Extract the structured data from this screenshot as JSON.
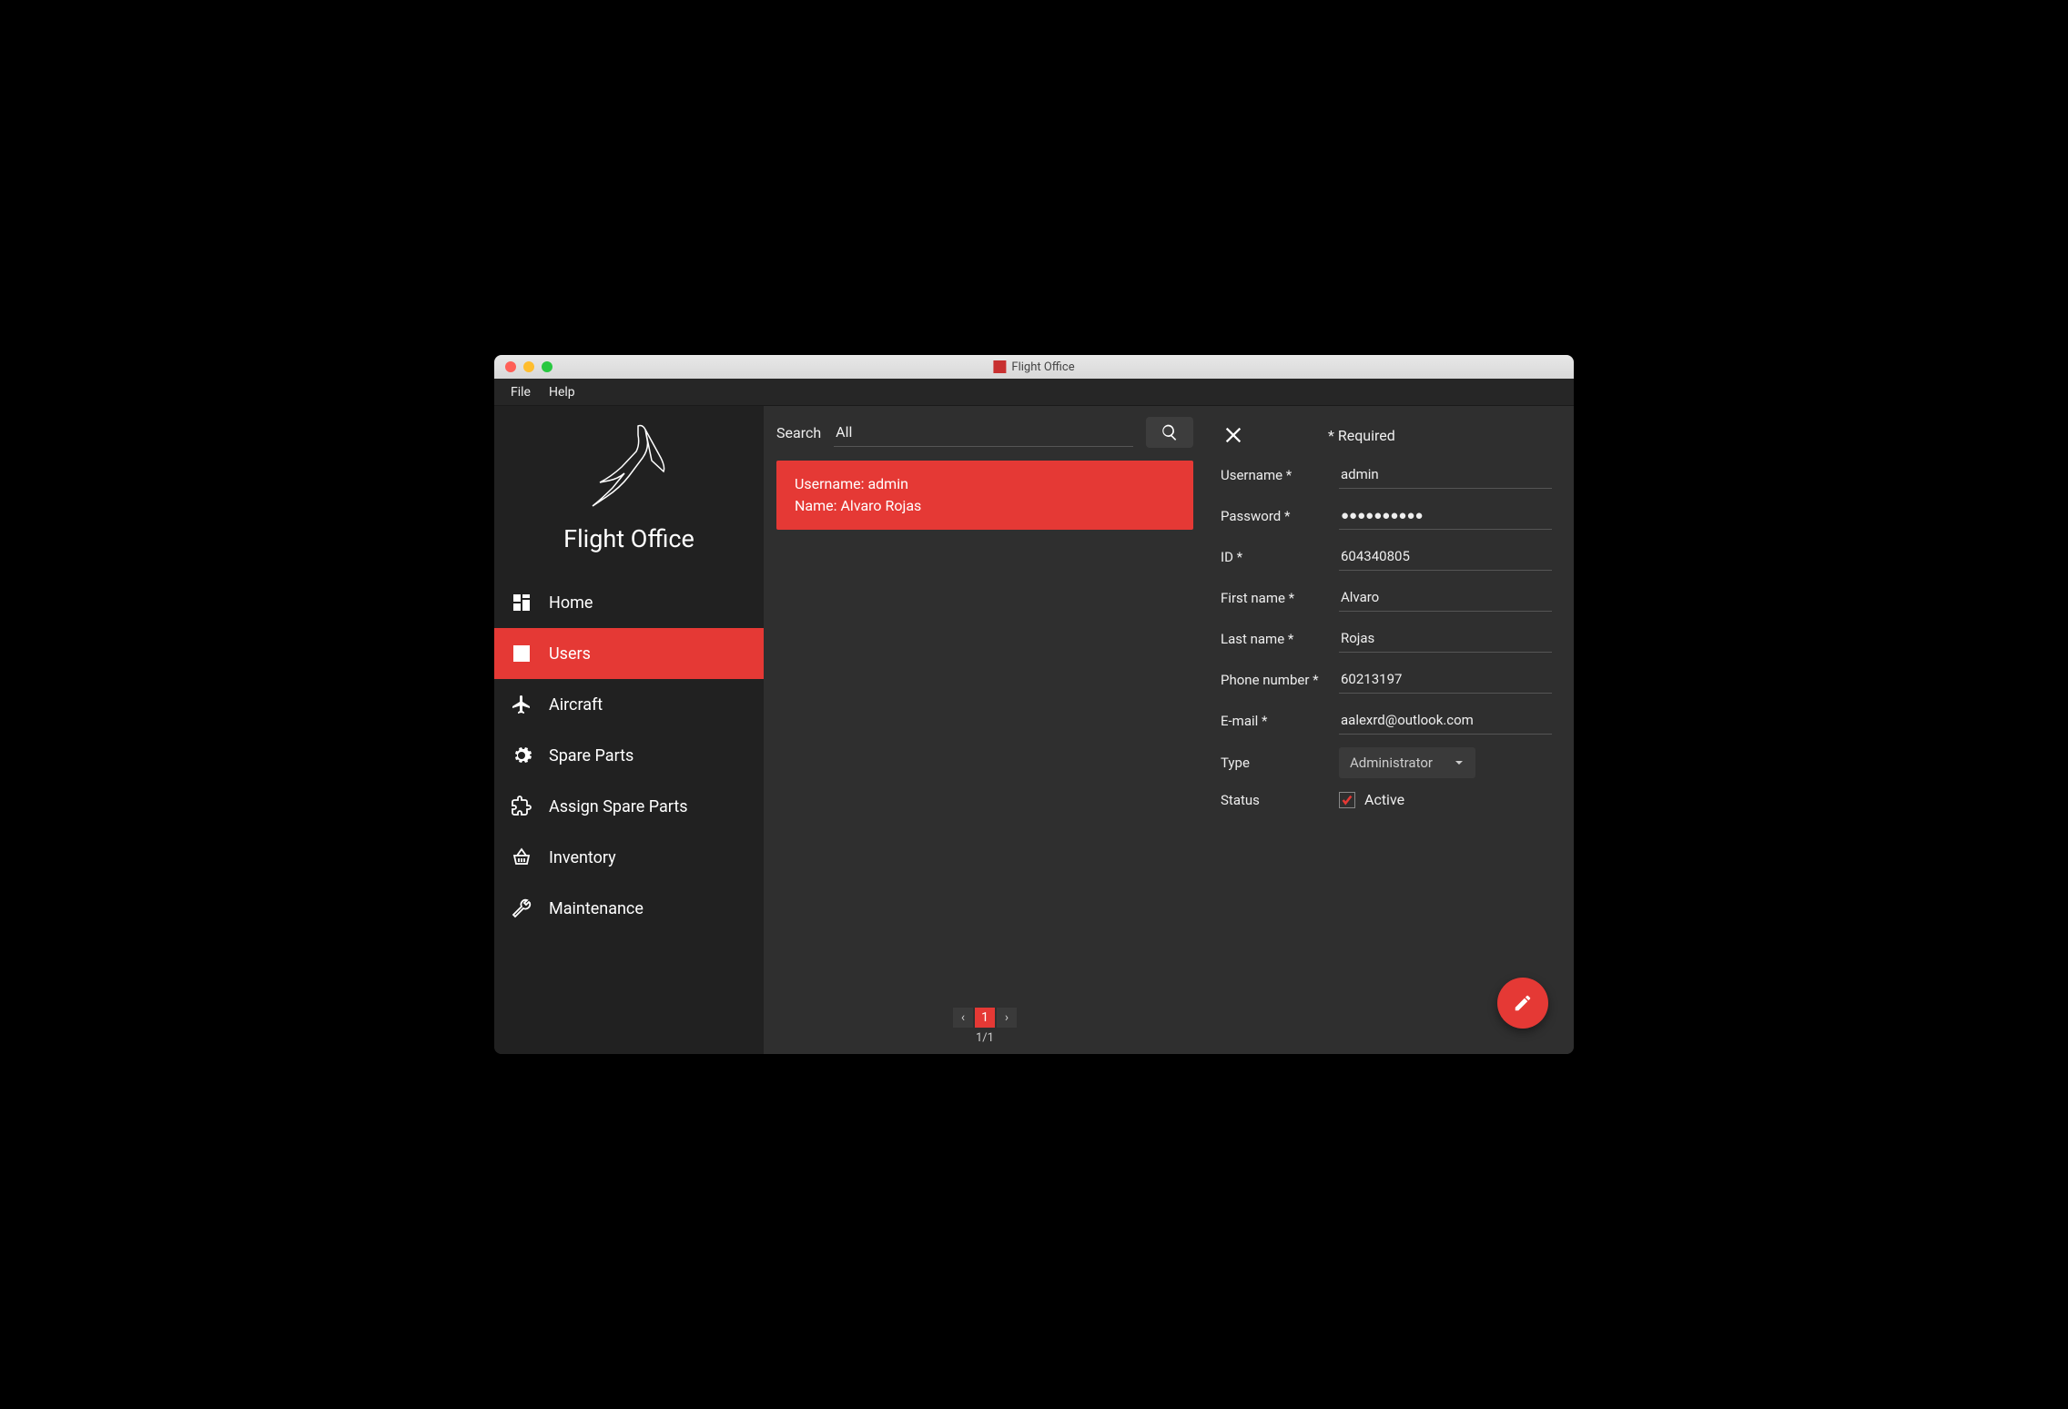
{
  "window": {
    "title": "Flight Office"
  },
  "menubar": {
    "file": "File",
    "help": "Help"
  },
  "sidebar": {
    "brand": "Flight Office",
    "items": [
      {
        "label": "Home"
      },
      {
        "label": "Users"
      },
      {
        "label": "Aircraft"
      },
      {
        "label": "Spare Parts"
      },
      {
        "label": "Assign Spare Parts"
      },
      {
        "label": "Inventory"
      },
      {
        "label": "Maintenance"
      }
    ]
  },
  "search": {
    "label": "Search",
    "value": "All"
  },
  "list": {
    "card": {
      "line1_label": "Username:",
      "line1_value": "admin",
      "line2_label": "Name:",
      "line2_value": "Alvaro Rojas"
    }
  },
  "pager": {
    "page": "1",
    "total": "1/1"
  },
  "detail": {
    "required_note": "* Required",
    "labels": {
      "username": "Username *",
      "password": "Password *",
      "id": "ID *",
      "first_name": "First name *",
      "last_name": "Last name *",
      "phone": "Phone number *",
      "email": "E-mail *",
      "type": "Type",
      "status": "Status"
    },
    "values": {
      "username": "admin",
      "password": "●●●●●●●●●●",
      "id": "604340805",
      "first_name": "Alvaro",
      "last_name": "Rojas",
      "phone": "60213197",
      "email": "aalexrd@outlook.com",
      "type": "Administrator",
      "status_label": "Active"
    }
  }
}
